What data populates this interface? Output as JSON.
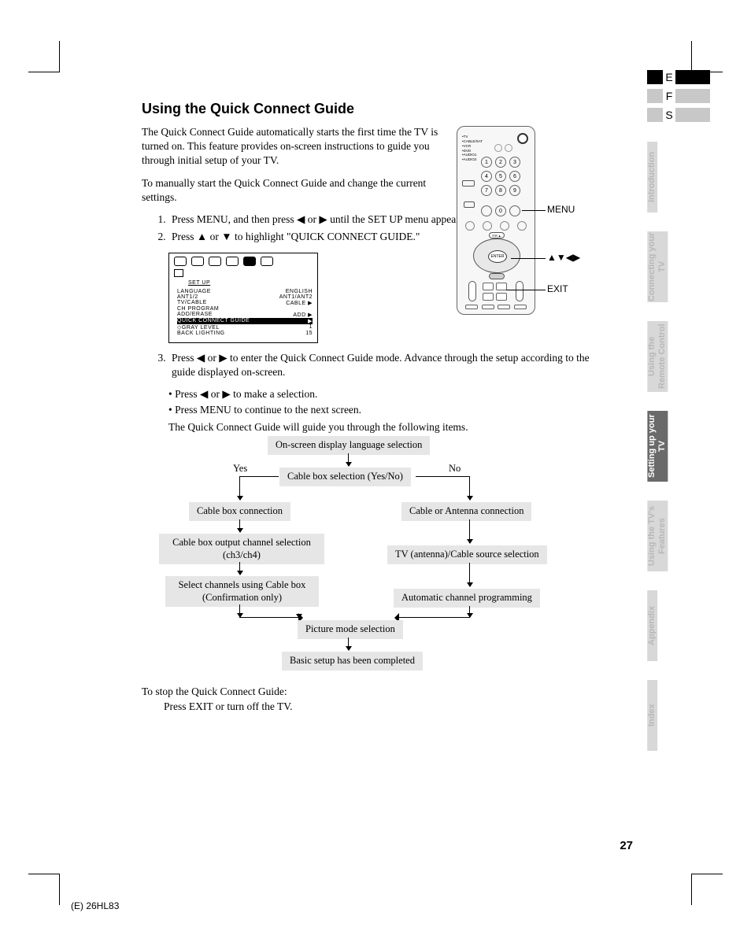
{
  "langs": [
    {
      "letter": "E",
      "sq": "#000",
      "bar": "#000"
    },
    {
      "letter": "F",
      "sq": "#c8c8c8",
      "bar": "#c8c8c8"
    },
    {
      "letter": "S",
      "sq": "#c8c8c8",
      "bar": "#c8c8c8"
    }
  ],
  "tabs": [
    {
      "label": "Introduction",
      "style": "light"
    },
    {
      "label": "Connecting your TV",
      "style": "light"
    },
    {
      "label": "Using the Remote Control",
      "style": "light"
    },
    {
      "label": "Setting up your TV",
      "style": "dark"
    },
    {
      "label": "Using the TV's Features",
      "style": "light"
    },
    {
      "label": "Appendix",
      "style": "light"
    },
    {
      "label": "Index",
      "style": "light"
    }
  ],
  "title": "Using the Quick Connect Guide",
  "para1": "The Quick Connect Guide automatically starts the first time the TV is turned on. This feature provides on-screen instructions to guide you through initial setup of your TV.",
  "para2": "To manually start the Quick Connect Guide and change the current settings.",
  "steps": {
    "s1a": "Press MENU, and then press ",
    "s1b": " or ",
    "s1c": " until the SET UP menu appears.",
    "s2a": "Press ",
    "s2b": " or ",
    "s2c": " to highlight \"QUICK CONNECT GUIDE.\"",
    "s3a": "Press ",
    "s3b": " or ",
    "s3c": " to enter the Quick Connect Guide mode. Advance through the setup according to the guide displayed on-screen.",
    "bullet1a": "• Press ",
    "bullet1b": " or ",
    "bullet1c": " to make a selection.",
    "bullet2": "• Press MENU to continue to the next screen.",
    "follow": "The Quick Connect Guide will guide you through the following items."
  },
  "osd": {
    "title": "SET  UP",
    "rows": [
      {
        "l": "LANGUAGE",
        "r": "ENGLISH"
      },
      {
        "l": "ANT1/2",
        "r": "ANT1/ANT2"
      },
      {
        "l": "TV/CABLE",
        "r": "CABLE        ▶"
      },
      {
        "l": "CH PROGRAM",
        "r": ""
      },
      {
        "l": "ADD/ERASE",
        "r": "ADD            ▶"
      },
      {
        "l": "QUICK CONNECT GUIDE",
        "r": "▶",
        "hl": true
      },
      {
        "l": "GRAY LEVEL",
        "r": "1"
      },
      {
        "l": "BACK LIGHTING",
        "r": "15"
      }
    ]
  },
  "remote": {
    "switches": "•TV\n•CABLE/SAT\n•VCR\n•DVD\n•AUDIO1\n•AUDIO2",
    "enter": "ENTER",
    "fav": "FAV▲"
  },
  "callouts": {
    "menu": "MENU",
    "arrows": "▲▼◀▶",
    "exit": "EXIT"
  },
  "flow": {
    "b1": "On-screen display language selection",
    "b2": "Cable box selection (Yes/No)",
    "b3": "Cable box connection",
    "b4": "Cable box output channel selection (ch3/ch4)",
    "b5": "Select channels using Cable box (Confirmation only)",
    "b6": "Cable or Antenna connection",
    "b7": "TV (antenna)/Cable source selection",
    "b8": "Automatic channel programming",
    "b9": "Picture mode selection",
    "b10": "Basic setup has been completed",
    "yes": "Yes",
    "no": "No"
  },
  "stop": {
    "l1": "To stop the Quick Connect Guide:",
    "l2": "Press EXIT or turn off the TV."
  },
  "page": "27",
  "footer": "(E) 26HL83"
}
